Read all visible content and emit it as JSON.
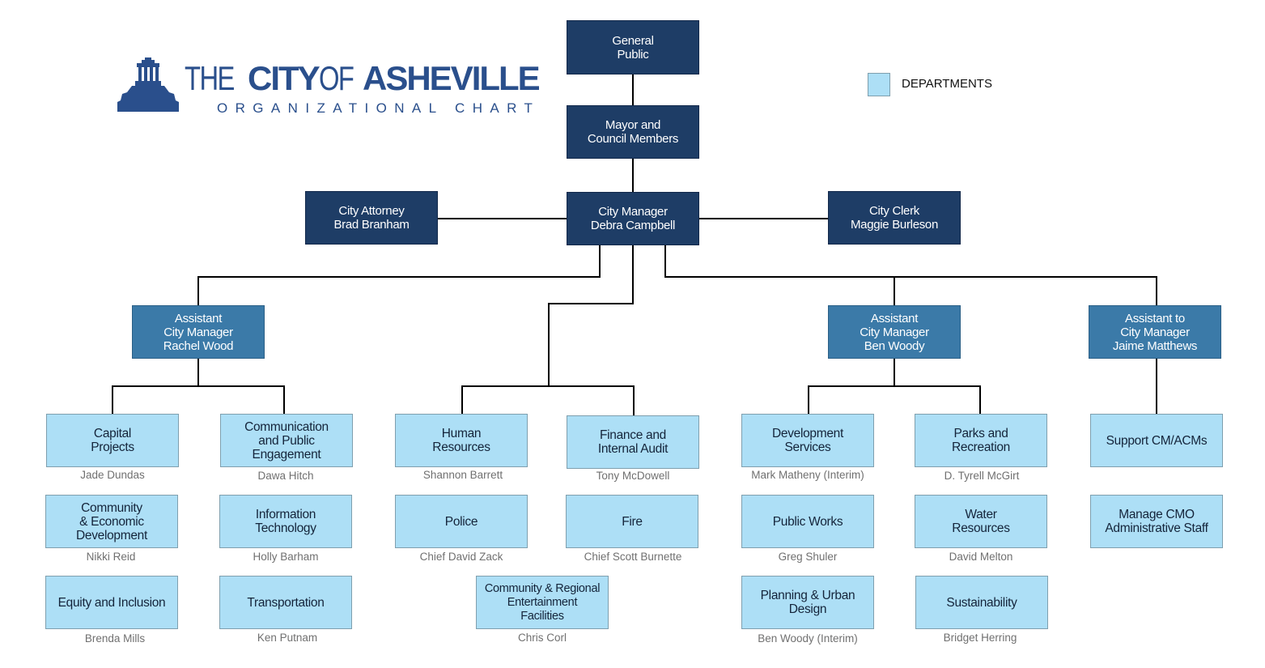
{
  "header": {
    "logo_icon": "city-hall-building-icon",
    "title_light_1": "THE",
    "title_bold_1": "CITY",
    "title_light_2": "OF",
    "title_bold_2": "ASHEVILLE",
    "subtitle": "ORGANIZATIONAL CHART"
  },
  "legend": {
    "label": "DEPARTMENTS",
    "color": "#addff6"
  },
  "colors": {
    "executive": "#1e3d66",
    "assistant_manager": "#3b7aa8",
    "department": "#addff6",
    "connector": "#000000"
  },
  "executive": {
    "general_public": "General\nPublic",
    "mayor_council": "Mayor and\nCouncil Members",
    "city_attorney": "City Attorney\nBrad Branham",
    "city_manager": "City Manager\nDebra Campbell",
    "city_clerk": "City Clerk\nMaggie Burleson"
  },
  "assistants": {
    "acm_rachel_wood": "Assistant\nCity Manager\nRachel Wood",
    "acm_ben_woody": "Assistant\nCity Manager\nBen Woody",
    "atcm_jaime_matthews": "Assistant to\nCity Manager\nJaime Matthews"
  },
  "departments": [
    {
      "name": "Capital\nProjects",
      "head": "Jade Dundas"
    },
    {
      "name": "Communication\nand Public\nEngagement",
      "head": "Dawa Hitch"
    },
    {
      "name": "Community\n& Economic\nDevelopment",
      "head": "Nikki Reid"
    },
    {
      "name": "Information\nTechnology",
      "head": "Holly Barham"
    },
    {
      "name": "Equity and Inclusion",
      "head": "Brenda Mills"
    },
    {
      "name": "Transportation",
      "head": "Ken Putnam"
    },
    {
      "name": "Human\nResources",
      "head": "Shannon Barrett"
    },
    {
      "name": "Finance and\nInternal Audit",
      "head": "Tony McDowell"
    },
    {
      "name": "Police",
      "head": "Chief David Zack"
    },
    {
      "name": "Fire",
      "head": "Chief Scott Burnette"
    },
    {
      "name": "Community & Regional\nEntertainment\nFacilities",
      "head": "Chris Corl"
    },
    {
      "name": "Development\nServices",
      "head": "Mark Matheny (Interim)"
    },
    {
      "name": "Parks and\nRecreation",
      "head": "D. Tyrell McGirt"
    },
    {
      "name": "Public Works",
      "head": "Greg Shuler"
    },
    {
      "name": "Water\nResources",
      "head": "David Melton"
    },
    {
      "name": "Planning & Urban\nDesign",
      "head": "Ben Woody (Interim)"
    },
    {
      "name": "Sustainability",
      "head": "Bridget Herring"
    },
    {
      "name": "Support CM/ACMs",
      "head": ""
    },
    {
      "name": "Manage CMO\nAdministrative Staff",
      "head": ""
    }
  ]
}
